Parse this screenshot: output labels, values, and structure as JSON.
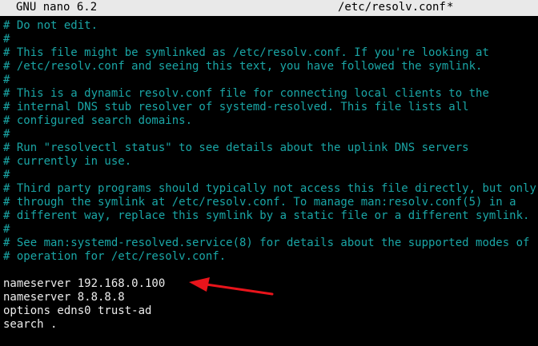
{
  "title_bar": {
    "app": "GNU nano 6.2",
    "file": "/etc/resolv.conf",
    "modified": "*"
  },
  "colors": {
    "comment": "#1aa6a6",
    "text": "#ececec",
    "title_bg": "#e9e9e9",
    "arrow": "#e8141b"
  },
  "lines": [
    {
      "type": "comment",
      "text": "# Do not edit."
    },
    {
      "type": "comment",
      "text": "#"
    },
    {
      "type": "comment",
      "text": "# This file might be symlinked as /etc/resolv.conf. If you're looking at"
    },
    {
      "type": "comment",
      "text": "# /etc/resolv.conf and seeing this text, you have followed the symlink."
    },
    {
      "type": "comment",
      "text": "#"
    },
    {
      "type": "comment",
      "text": "# This is a dynamic resolv.conf file for connecting local clients to the"
    },
    {
      "type": "comment",
      "text": "# internal DNS stub resolver of systemd-resolved. This file lists all"
    },
    {
      "type": "comment",
      "text": "# configured search domains."
    },
    {
      "type": "comment",
      "text": "#"
    },
    {
      "type": "comment",
      "text": "# Run \"resolvectl status\" to see details about the uplink DNS servers"
    },
    {
      "type": "comment",
      "text": "# currently in use."
    },
    {
      "type": "comment",
      "text": "#"
    },
    {
      "type": "comment",
      "text": "# Third party programs should typically not access this file directly, but only"
    },
    {
      "type": "comment",
      "text": "# through the symlink at /etc/resolv.conf. To manage man:resolv.conf(5) in a"
    },
    {
      "type": "comment",
      "text": "# different way, replace this symlink by a static file or a different symlink."
    },
    {
      "type": "comment",
      "text": "#"
    },
    {
      "type": "comment",
      "text": "# See man:systemd-resolved.service(8) for details about the supported modes of"
    },
    {
      "type": "comment",
      "text": "# operation for /etc/resolv.conf."
    },
    {
      "type": "blank",
      "text": ""
    },
    {
      "type": "config",
      "text": "nameserver 192.168.0.100"
    },
    {
      "type": "config",
      "text": "nameserver 8.8.8.8"
    },
    {
      "type": "config",
      "text": "options edns0 trust-ad"
    },
    {
      "type": "config",
      "text": "search ."
    }
  ]
}
